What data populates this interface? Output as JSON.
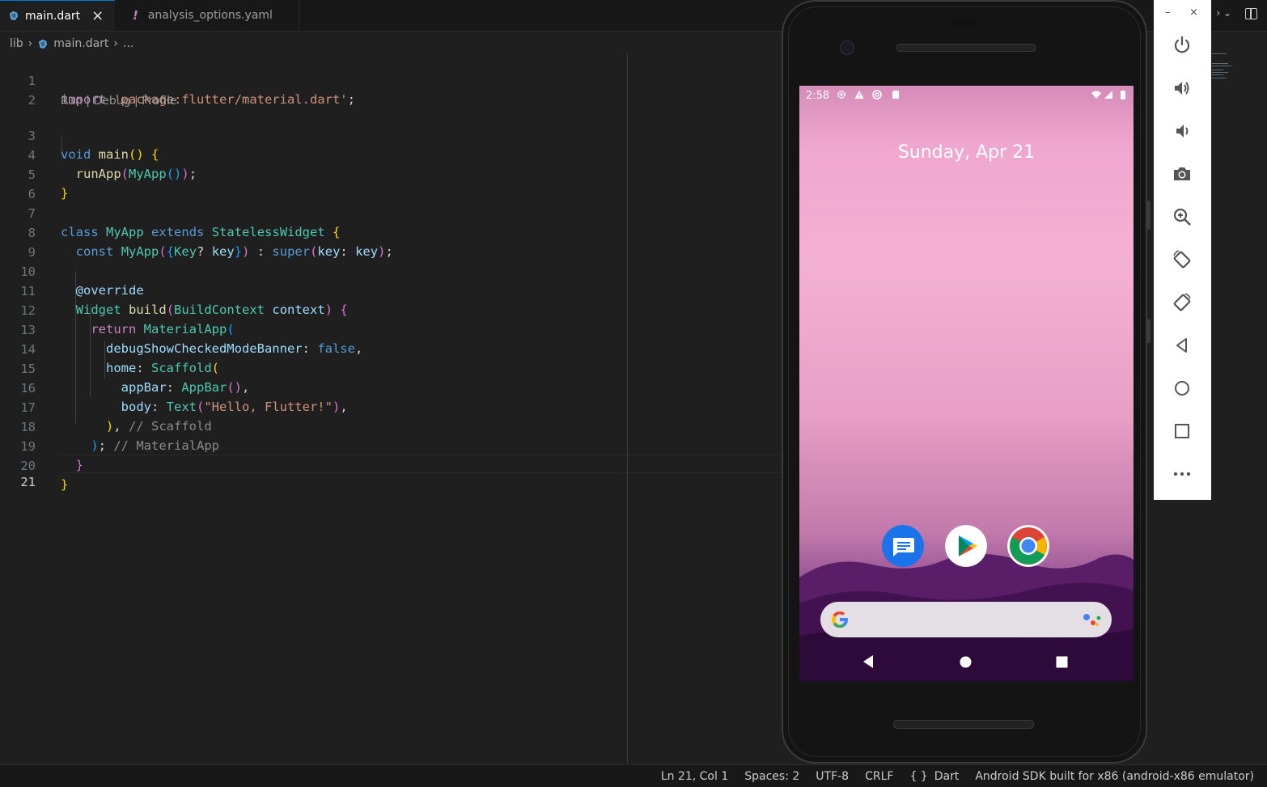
{
  "tabs": [
    {
      "label": "main.dart",
      "active": true,
      "close": "×"
    },
    {
      "label": "analysis_options.yaml",
      "active": false,
      "icon": "!"
    }
  ],
  "breadcrumb": {
    "folder": "lib",
    "file": "main.dart",
    "more": "..."
  },
  "codelens": "Run | Debug | Profile",
  "line_numbers": [
    "1",
    "2",
    "3",
    "4",
    "5",
    "6",
    "7",
    "8",
    "9",
    "10",
    "11",
    "12",
    "13",
    "14",
    "15",
    "16",
    "17",
    "18",
    "19",
    "20",
    "21"
  ],
  "code": {
    "l1_import": "import",
    "l1_str": "'package:flutter/material.dart'",
    "l3_void": "void",
    "l3_main": "main",
    "l4_runapp": "runApp",
    "l4_myapp": "MyApp",
    "l7_class": "class",
    "l7_name": "MyApp",
    "l7_extends": "extends",
    "l7_super": "StatelessWidget",
    "l8_const": "const",
    "l8_name": "MyApp",
    "l8_key_type": "Key",
    "l8_key": "key",
    "l8_super": "super",
    "l8_key2": "key",
    "l8_key3": "key",
    "l10_ann": "@override",
    "l11_widget": "Widget",
    "l11_build": "build",
    "l11_ctxtype": "BuildContext",
    "l11_ctx": "context",
    "l12_return": "return",
    "l12_material": "MaterialApp",
    "l13_prop": "debugShowCheckedModeBanner",
    "l13_val": "false",
    "l14_prop": "home",
    "l14_scaffold": "Scaffold",
    "l15_prop": "appBar",
    "l15_appbar": "AppBar",
    "l16_prop": "body",
    "l16_text": "Text",
    "l16_str": "\"Hello, Flutter!\"",
    "l17_comment": "// Scaffold",
    "l18_comment": "// MaterialApp"
  },
  "status_bar": {
    "position": "Ln 21, Col 1",
    "spaces": "Spaces: 2",
    "encoding": "UTF-8",
    "eol": "CRLF",
    "language_icon": "{ }",
    "language": "Dart",
    "device": "Android SDK built for x86 (android-x86 emulator)"
  },
  "emulator": {
    "time": "2:58",
    "date": "Sunday, Apr 21",
    "window_controls": {
      "minimize": "–",
      "close": "×"
    },
    "apps": [
      {
        "name": "messages-app-icon",
        "color": "#1a73e8"
      },
      {
        "name": "play-store-app-icon",
        "color": "#ffffff"
      },
      {
        "name": "chrome-app-icon",
        "color": "#ffffff"
      }
    ],
    "tools": [
      "power-icon",
      "volume-up-icon",
      "volume-down-icon",
      "camera-icon",
      "zoom-icon",
      "rotate-left-icon",
      "rotate-right-icon",
      "back-icon",
      "home-icon",
      "overview-icon",
      "more-icon"
    ]
  },
  "colors": {
    "accent": "#0078d4",
    "editor_bg": "#1f1f1f",
    "keyword": "#569cd6",
    "string": "#ce9178",
    "type": "#4ec9b0",
    "function": "#dcdcaa"
  }
}
